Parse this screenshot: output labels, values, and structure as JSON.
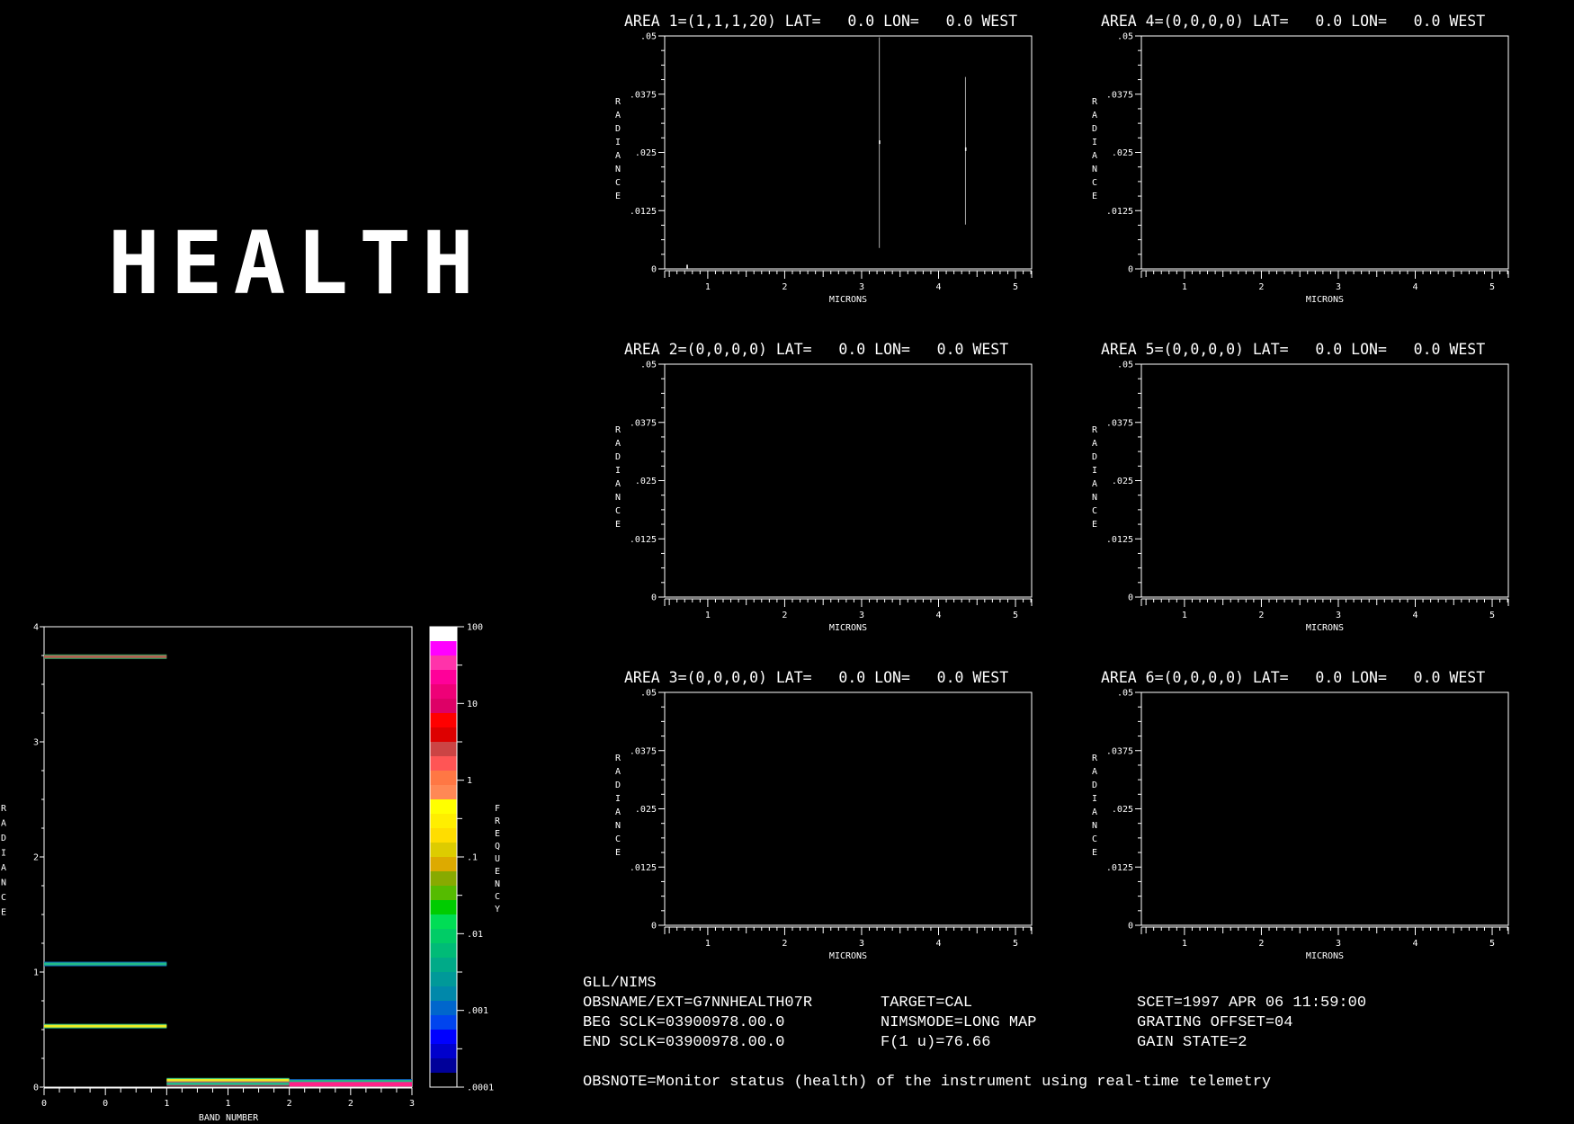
{
  "header": {
    "title": "HEALTH"
  },
  "info": {
    "instrument": "GLL/NIMS",
    "obsname": "OBSNAME/EXT=G7NNHEALTH07R",
    "beg_sclk": "BEG SCLK=03900978.00.0",
    "end_sclk": "END SCLK=03900978.00.0",
    "target": "TARGET=CAL",
    "nimsmode": "NIMSMODE=LONG MAP",
    "f1u": "F(1 u)=76.66",
    "scet": "SCET=1997 APR 06 11:59:00",
    "grating_offset": "GRATING OFFSET=04",
    "gain_state": "GAIN STATE=2",
    "obsnote": "OBSNOTE=Monitor status (health) of the instrument using real-time telemetry"
  },
  "chart_data": [
    {
      "type": "line",
      "title": "",
      "xlabel": "BAND NUMBER",
      "ylabel": "RADIANCE",
      "xlim": [
        0,
        3
      ],
      "ylim": [
        0,
        4
      ],
      "x_tick_values": [
        0,
        0.5,
        1,
        1.5,
        2,
        2.5,
        3
      ],
      "x_tick_labels": [
        "0",
        "0",
        "1",
        "1",
        "2",
        "2",
        "3"
      ],
      "y_tick_labels": [
        "0",
        "1",
        "2",
        "3",
        "4"
      ],
      "grid": false,
      "segments": [
        {
          "x": [
            0,
            1
          ],
          "y": 3.74,
          "color": "#b06050",
          "edge": "#33aa66"
        },
        {
          "x": [
            0,
            1
          ],
          "y": 1.07,
          "color": "#22bb88",
          "edge": "#1166bb"
        },
        {
          "x": [
            0,
            1
          ],
          "y": 0.53,
          "color": "#eeee22",
          "edge": "#22bb88"
        },
        {
          "x": [
            1,
            2
          ],
          "y": 0.06,
          "color": "#eeee22",
          "edge": "#22bb88"
        },
        {
          "x": [
            1,
            2
          ],
          "y": 0.03,
          "color": "#22bb88",
          "edge": "#cc4466"
        },
        {
          "x": [
            2,
            3
          ],
          "y": 0.05,
          "color": "#22bb88",
          "edge": "#1166bb"
        },
        {
          "x": [
            2,
            3
          ],
          "y": 0.025,
          "color": "#ff2288",
          "edge": "#ff2288"
        }
      ],
      "colorbar": {
        "label": "FREQUENCY",
        "scale": "log",
        "range": [
          0.0001,
          100
        ],
        "tick_labels": [
          "100",
          "10",
          "1",
          ".1",
          ".01",
          ".001",
          ".0001"
        ],
        "colors_top_to_bottom": [
          "#ffffff",
          "#ff00ff",
          "#ff33aa",
          "#ff0099",
          "#ee0077",
          "#dd0066",
          "#ff0000",
          "#dd0000",
          "#cc4444",
          "#ff5555",
          "#ff7744",
          "#ff8855",
          "#ffff00",
          "#ffee00",
          "#ffdd00",
          "#ddcc00",
          "#ddaa00",
          "#88aa00",
          "#55bb00",
          "#00cc00",
          "#00dd55",
          "#00cc66",
          "#00bb77",
          "#00aa88",
          "#009999",
          "#0088aa",
          "#0066cc",
          "#0044ee",
          "#0000ff",
          "#0000cc",
          "#000099",
          "#000000"
        ]
      }
    },
    {
      "type": "line",
      "title": "AREA 1=(1,1,1,20) LAT=   0.0 LON=   0.0 WEST",
      "xlabel": "MICRONS",
      "ylabel": "RADIANCE",
      "xlim": [
        0.44,
        5.21
      ],
      "ylim": [
        0,
        0.05
      ],
      "x_tick_labels": [
        "1",
        "2",
        "3",
        "4",
        "5"
      ],
      "y_tick_labels": [
        "0",
        ".0125",
        ".025",
        ".0375",
        ".05"
      ],
      "vlines": [
        {
          "x": 3.23,
          "y": [
            0.0045,
            0.0497
          ],
          "mark": 0.0272
        },
        {
          "x": 4.35,
          "y": [
            0.0095,
            0.0412
          ],
          "mark": 0.0257
        },
        {
          "x": 0.73,
          "y": [
            0.0002,
            0.0008
          ],
          "mark": 0.0005
        }
      ]
    },
    {
      "type": "line",
      "title": "AREA 2=(0,0,0,0) LAT=   0.0 LON=   0.0 WEST",
      "xlabel": "MICRONS",
      "ylabel": "RADIANCE",
      "xlim": [
        0.44,
        5.21
      ],
      "ylim": [
        0,
        0.05
      ],
      "x_tick_labels": [
        "1",
        "2",
        "3",
        "4",
        "5"
      ],
      "y_tick_labels": [
        "0",
        ".0125",
        ".025",
        ".0375",
        ".05"
      ],
      "vlines": []
    },
    {
      "type": "line",
      "title": "AREA 3=(0,0,0,0) LAT=   0.0 LON=   0.0 WEST",
      "xlabel": "MICRONS",
      "ylabel": "RADIANCE",
      "xlim": [
        0.44,
        5.21
      ],
      "ylim": [
        0,
        0.05
      ],
      "x_tick_labels": [
        "1",
        "2",
        "3",
        "4",
        "5"
      ],
      "y_tick_labels": [
        "0",
        ".0125",
        ".025",
        ".0375",
        ".05"
      ],
      "vlines": []
    },
    {
      "type": "line",
      "title": "AREA 4=(0,0,0,0) LAT=   0.0 LON=   0.0 WEST",
      "xlabel": "MICRONS",
      "ylabel": "RADIANCE",
      "xlim": [
        0.44,
        5.21
      ],
      "ylim": [
        0,
        0.05
      ],
      "x_tick_labels": [
        "1",
        "2",
        "3",
        "4",
        "5"
      ],
      "y_tick_labels": [
        "0",
        ".0125",
        ".025",
        ".0375",
        ".05"
      ],
      "vlines": []
    },
    {
      "type": "line",
      "title": "AREA 5=(0,0,0,0) LAT=   0.0 LON=   0.0 WEST",
      "xlabel": "MICRONS",
      "ylabel": "RADIANCE",
      "xlim": [
        0.44,
        5.21
      ],
      "ylim": [
        0,
        0.05
      ],
      "x_tick_labels": [
        "1",
        "2",
        "3",
        "4",
        "5"
      ],
      "y_tick_labels": [
        "0",
        ".0125",
        ".025",
        ".0375",
        ".05"
      ],
      "vlines": []
    },
    {
      "type": "line",
      "title": "AREA 6=(0,0,0,0) LAT=   0.0 LON=   0.0 WEST",
      "xlabel": "MICRONS",
      "ylabel": "RADIANCE",
      "xlim": [
        0.44,
        5.21
      ],
      "ylim": [
        0,
        0.05
      ],
      "x_tick_labels": [
        "1",
        "2",
        "3",
        "4",
        "5"
      ],
      "y_tick_labels": [
        "0",
        ".0125",
        ".025",
        ".0375",
        ".05"
      ],
      "vlines": []
    }
  ]
}
